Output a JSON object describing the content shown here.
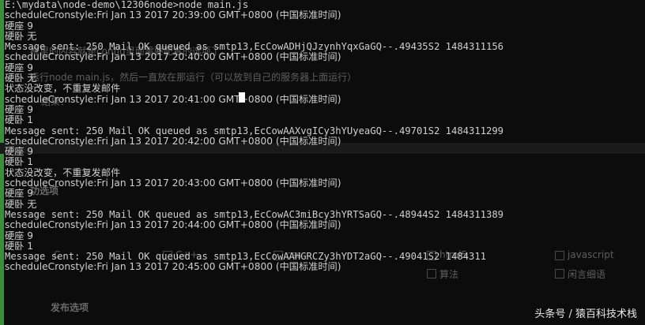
{
  "background_page": {
    "texts": [
      "框里的内容就是config里面需要配置的选项了。",
      "运行node main.js，然后一直放在那运行（可以放到自己的服务器上面运行）",
      "结果：",
      "功选项",
      "C",
      "C++",
      "css",
      "html5",
      "javascript",
      "算法",
      "闲言细语",
      "发布选项"
    ]
  },
  "terminal": {
    "lines": [
      "E:\\mydata\\node-demo\\12306node>node main.js",
      "scheduleCronstyle:Fri Jan 13 2017 20:39:00 GMT+0800 (中国标准时间)",
      "硬座 9",
      "硬卧 无",
      "Message sent: 250 Mail OK queued as smtp13,EcCowADHjQJzynhYqxGaGQ--.49435S2 1484311156",
      "scheduleCronstyle:Fri Jan 13 2017 20:40:00 GMT+0800 (中国标准时间)",
      "硬座 9",
      "硬卧 无",
      "状态没改变，不重复发邮件",
      "scheduleCronstyle:Fri Jan 13 2017 20:41:00 GMT+0800 (中国标准时间)",
      "硬座 9",
      "硬卧 1",
      "Message sent: 250 Mail OK queued as smtp13,EcCowAAXvgICy3hYUyeaGQ--.49701S2 1484311299",
      "scheduleCronstyle:Fri Jan 13 2017 20:42:00 GMT+0800 (中国标准时间)",
      "硬座 9",
      "硬卧 1",
      "状态没改变，不重复发邮件",
      "scheduleCronstyle:Fri Jan 13 2017 20:43:00 GMT+0800 (中国标准时间)",
      "硬座 9",
      "硬卧 无",
      "Message sent: 250 Mail OK queued as smtp13,EcCowAC3miBcy3hYRTSaGQ--.48944S2 1484311389",
      "scheduleCronstyle:Fri Jan 13 2017 20:44:00 GMT+0800 (中国标准时间)",
      "硬座 9",
      "硬卧 1",
      "Message sent: 250 Mail OK queued as smtp13,EcCowAAHGRCZy3hYDT2aGQ--.49041S2 1484311",
      "scheduleCronstyle:Fri Jan 13 2017 20:45:00 GMT+0800 (中国标准时间)"
    ]
  },
  "watermark": "头条号 / 猿百科技术栈",
  "colors": {
    "terminal_bg": "#0c0c0c",
    "terminal_text": "#cfcfcf",
    "edge_accent": "#3a8f3a"
  }
}
